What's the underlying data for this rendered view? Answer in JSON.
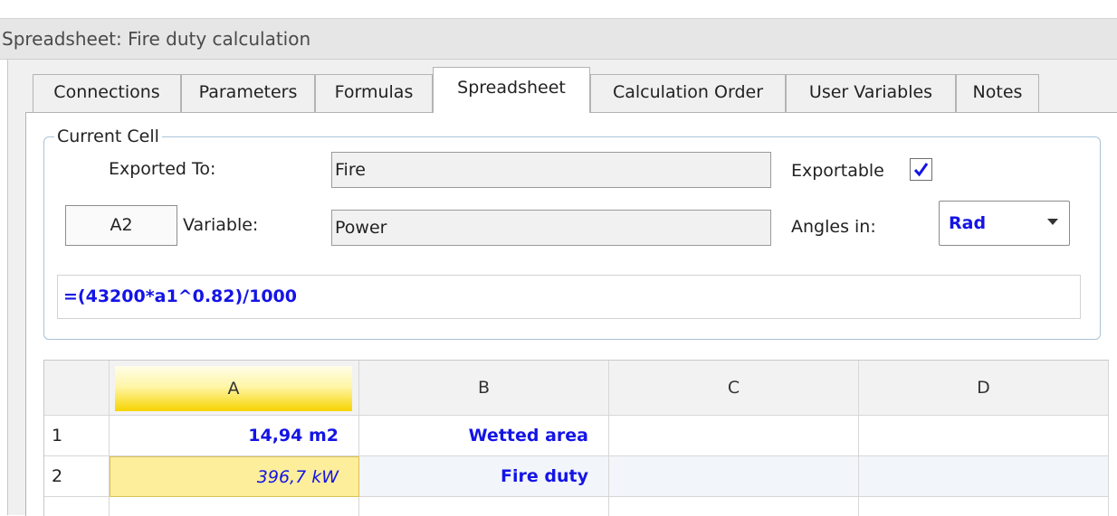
{
  "window": {
    "title": "Spreadsheet: Fire duty calculation"
  },
  "tabs": [
    {
      "label": "Connections",
      "active": false
    },
    {
      "label": "Parameters",
      "active": false
    },
    {
      "label": "Formulas",
      "active": false
    },
    {
      "label": "Spreadsheet",
      "active": true
    },
    {
      "label": "Calculation Order",
      "active": false
    },
    {
      "label": "User Variables",
      "active": false
    },
    {
      "label": "Notes",
      "active": false
    }
  ],
  "current_cell": {
    "group_title": "Current Cell",
    "exported_to_label": "Exported To:",
    "exported_to_value": "Fire",
    "exportable_label": "Exportable",
    "exportable_checked": true,
    "cell_ref": "A2",
    "variable_label": "Variable:",
    "variable_value": "Power",
    "angles_label": "Angles in:",
    "angles_value": "Rad",
    "formula": "=(43200*a1^0.82)/1000"
  },
  "grid": {
    "columns": [
      "A",
      "B",
      "C",
      "D"
    ],
    "rows": [
      {
        "num": "1",
        "cells": [
          "14,94 m2",
          "Wetted area",
          "",
          ""
        ]
      },
      {
        "num": "2",
        "cells": [
          "396,7 kW",
          "Fire duty",
          "",
          ""
        ]
      }
    ]
  },
  "colors": {
    "accent_blue": "#1414e6",
    "selected_header": "#f7d400",
    "selected_cell": "#fdee9c"
  }
}
